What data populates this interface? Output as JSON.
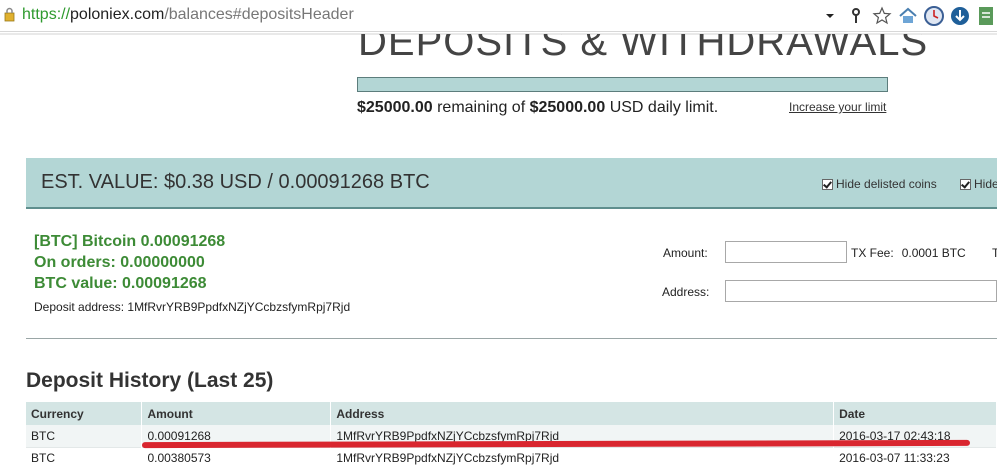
{
  "browser": {
    "url_scheme": "https://",
    "url_host": "poloniex.com",
    "url_path": "/balances#depositsHeader"
  },
  "header": {
    "title": "DEPOSITS & WITHDRAWALS",
    "limit_remaining": "$25000.00",
    "limit_remaining_of": "remaining of",
    "limit_total": "$25000.00",
    "limit_suffix": "USD daily limit.",
    "increase_link": "Increase your limit",
    "limit_used_fraction": 0
  },
  "est": {
    "title": "EST. VALUE: $0.38 USD / 0.00091268 BTC",
    "hide_delisted": "Hide delisted coins",
    "hide_other": "Hide"
  },
  "coin": {
    "name_line": "[BTC] Bitcoin 0.00091268",
    "orders_line": "On orders: 0.00000000",
    "value_line": "BTC value: 0.00091268",
    "deposit_address_label": "Deposit address:",
    "deposit_address": "1MfRvrYRB9PpdfxNZjYCcbzsfymRpj7Rjd"
  },
  "withdraw": {
    "amount_label": "Amount:",
    "txfee_label": "TX Fee:",
    "txfee_value": "0.0001 BTC",
    "stray": "T",
    "address_label": "Address:"
  },
  "history": {
    "title": "Deposit History (Last 25)",
    "columns": [
      "Currency",
      "Amount",
      "Address",
      "Date"
    ],
    "rows": [
      [
        "BTC",
        "0.00091268",
        "1MfRvrYRB9PpdfxNZjYCcbzsfymRpj7Rjd",
        "2016-03-17 02:43:18"
      ],
      [
        "BTC",
        "0.00380573",
        "1MfRvrYRB9PpdfxNZjYCcbzsfymRpj7Rjd",
        "2016-03-07 11:33:23"
      ]
    ]
  },
  "colors": {
    "band": "#b3d6d5",
    "coin_green": "#3d8b36",
    "annotation_red": "#d9262f"
  }
}
